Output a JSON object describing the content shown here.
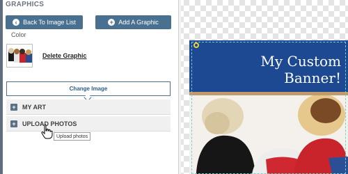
{
  "panel": {
    "title": "GRAPHICS",
    "back_button": "Back To Image List",
    "add_button": "Add A Graphic",
    "color_label": "Color",
    "delete_link": "Delete Graphic",
    "change_image": "Change Image",
    "accordion": [
      {
        "label": "MY ART",
        "icon": "plus-icon"
      },
      {
        "label": "UPLOAD PHOTOS",
        "icon": "plus-icon"
      }
    ],
    "tooltip": "Upload photos"
  },
  "preview": {
    "banner_title": "My Custom Banner!",
    "colors": {
      "banner": "#1d4892",
      "stripe": "#c19a6b",
      "accent": "#49718f"
    }
  }
}
